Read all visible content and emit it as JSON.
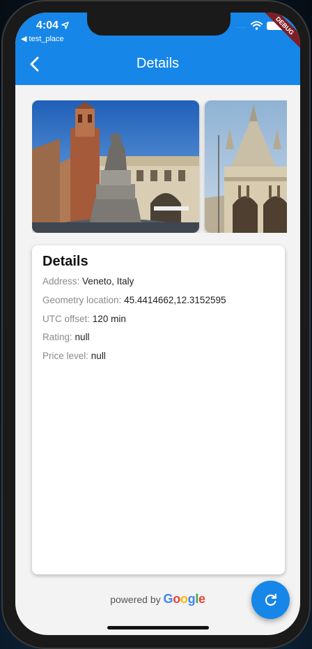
{
  "status_bar": {
    "time": "4:04",
    "back_app_label": "◀ test_place",
    "signal": "....",
    "debug_banner": "DEBUG"
  },
  "app_bar": {
    "title": "Details",
    "back_icon": "chevron-left-icon"
  },
  "gallery": {
    "photos": [
      {
        "name": "verona-statue-photo"
      },
      {
        "name": "venice-basilica-photo"
      }
    ]
  },
  "details_card": {
    "title": "Details",
    "rows": [
      {
        "label": "Address:",
        "value": "Veneto, Italy"
      },
      {
        "label": "Geometry location:",
        "value": "45.4414662,12.3152595"
      },
      {
        "label": "UTC offset:",
        "value": "120 min"
      },
      {
        "label": "Rating:",
        "value": "null"
      },
      {
        "label": "Price level:",
        "value": "null"
      }
    ]
  },
  "attribution": {
    "prefix": "powered by",
    "brand_letters": [
      "G",
      "o",
      "o",
      "g",
      "l",
      "e"
    ],
    "brand_colors": [
      "#4285F4",
      "#EA4335",
      "#FBBC05",
      "#4285F4",
      "#34A853",
      "#EA4335"
    ]
  },
  "fab": {
    "icon": "refresh-icon"
  },
  "colors": {
    "app_bar": "#1686e8",
    "background": "#f3f3f3",
    "card": "#ffffff",
    "label": "#8a8a8a"
  }
}
